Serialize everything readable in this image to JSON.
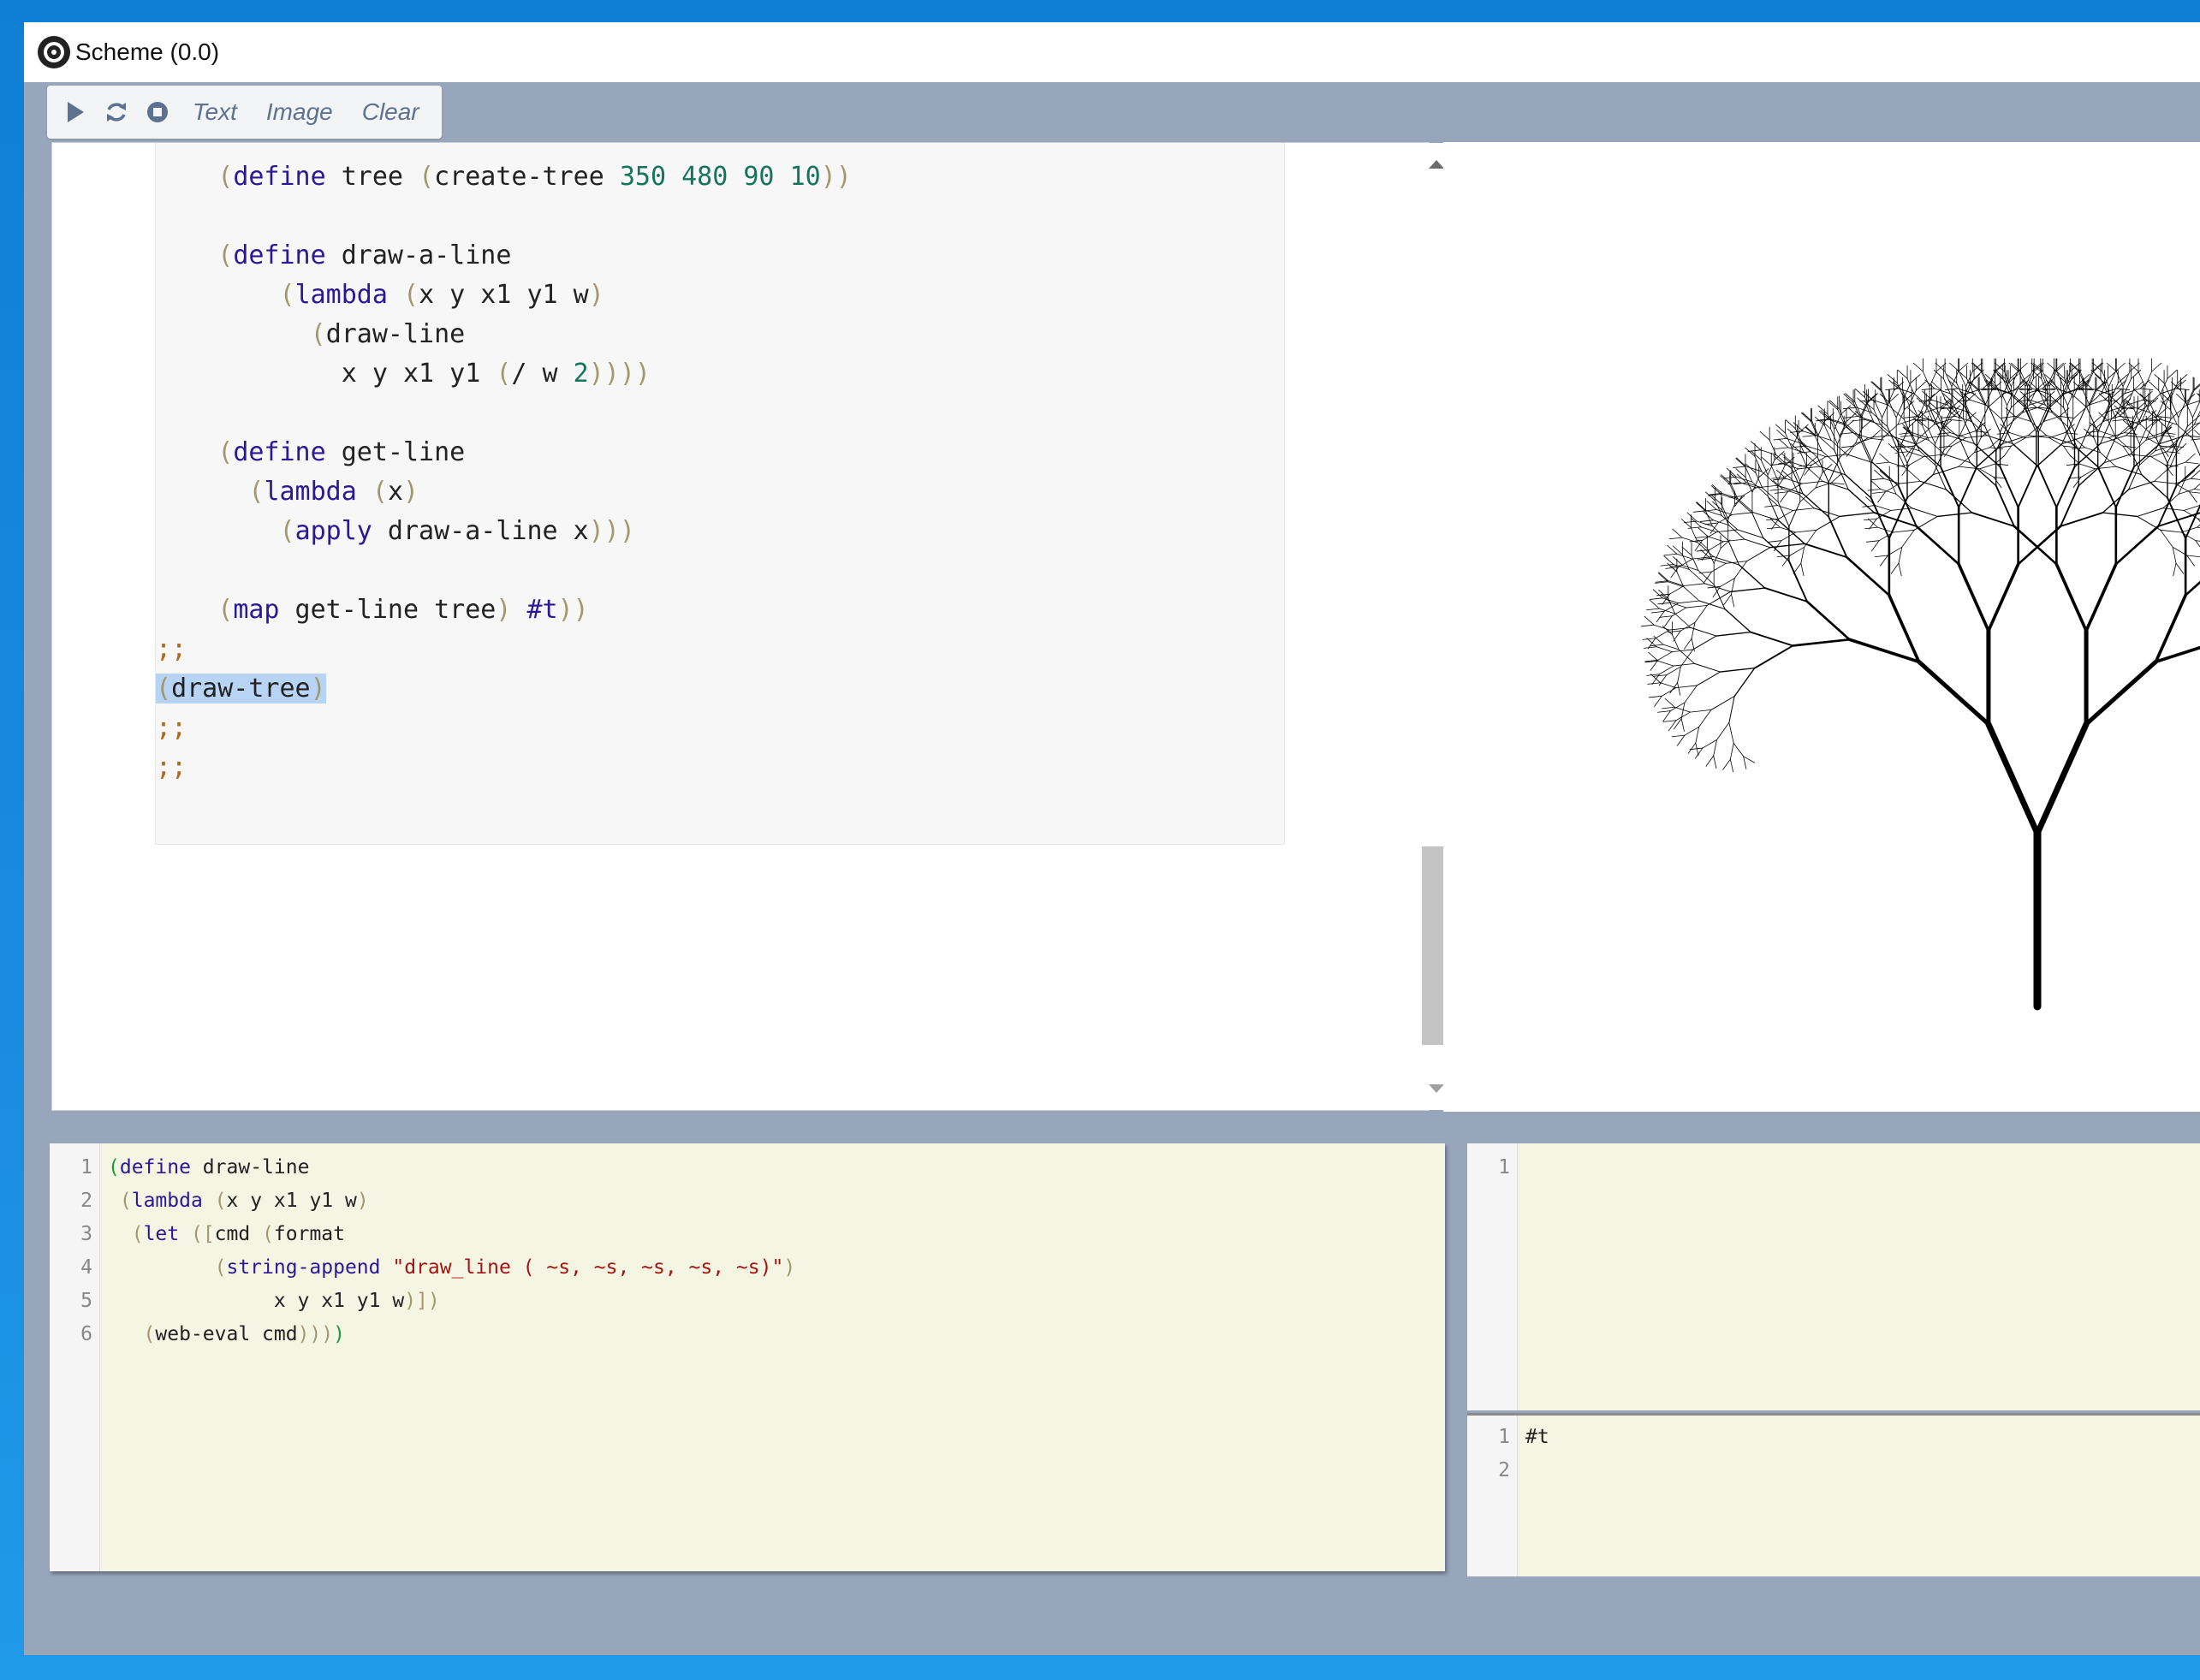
{
  "window": {
    "title": "Scheme (0.0)"
  },
  "toolbar": {
    "run_icon": "play-icon",
    "reload_icon": "reload-icon",
    "stop_icon": "stop-icon",
    "text_label": "Text",
    "image_label": "Image",
    "clear_label": "Clear"
  },
  "editor": {
    "lines": [
      "    (define tree (create-tree 350 480 90 10))",
      "",
      "    (define draw-a-line",
      "        (lambda (x y x1 y1 w)",
      "          (draw-line",
      "            x y x1 y1 (/ w 2))))",
      "",
      "    (define get-line",
      "      (lambda (x)",
      "        (apply draw-a-line x)))",
      "",
      "    (map get-line tree) #t))",
      ";;",
      "(draw-tree)",
      ";;",
      ";;"
    ]
  },
  "repl_input": {
    "line_numbers": [
      "1",
      "2",
      "3",
      "4",
      "5",
      "6"
    ],
    "lines": [
      "(define draw-line",
      " (lambda (x y x1 y1 w)",
      "  (let ([cmd (format",
      "         (string-append \"draw_line ( ~s, ~s, ~s, ~s, ~s)\")",
      "              x y x1 y1 w)])",
      "   (web-eval cmd))))"
    ]
  },
  "repl_output_top": {
    "line_numbers": [
      "1"
    ]
  },
  "repl_output_bottom": {
    "line_numbers": [
      "1",
      "2"
    ],
    "lines": [
      "#t",
      ""
    ]
  },
  "colors": {
    "window_bg": "#97a6bb",
    "keyword": "#2a1896",
    "number": "#16745a",
    "comment": "#b06a1e",
    "string": "#a31515",
    "selection": "#b7d4f5",
    "repl_bg": "#f5f5e4"
  }
}
